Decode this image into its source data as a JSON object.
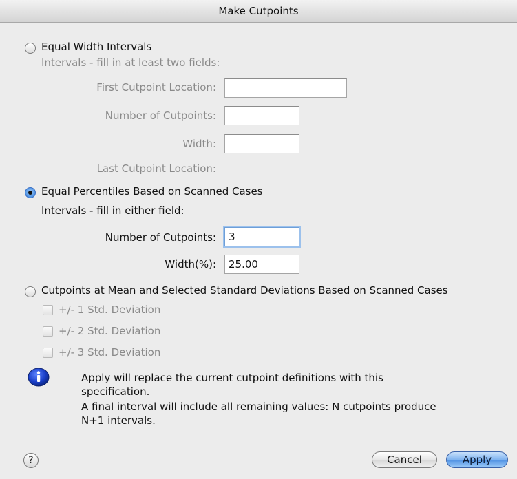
{
  "window": {
    "title": "Make Cutpoints"
  },
  "equal_width": {
    "label": "Equal Width Intervals",
    "hint": "Intervals - fill in at least two fields:",
    "first_cutpoint_label": "First Cutpoint Location:",
    "first_cutpoint_value": "",
    "num_cutpoints_label": "Number of Cutpoints:",
    "num_cutpoints_value": "",
    "width_label": "Width:",
    "width_value": "",
    "last_cutpoint_label": "Last Cutpoint Location:"
  },
  "equal_percentiles": {
    "label": "Equal Percentiles Based on Scanned Cases",
    "hint": "Intervals - fill in either field:",
    "num_cutpoints_label": "Number of Cutpoints:",
    "num_cutpoints_value": "3",
    "width_label": "Width(%):",
    "width_value": "25.00"
  },
  "mean_sd": {
    "label": "Cutpoints at Mean and Selected Standard Deviations Based on Scanned Cases",
    "options": [
      "+/- 1 Std. Deviation",
      "+/- 2 Std. Deviation",
      "+/- 3 Std. Deviation"
    ]
  },
  "info": {
    "line1": "Apply will replace the current cutpoint definitions with this",
    "line2": "specification.",
    "line3": "A final interval will include all remaining values: N cutpoints produce",
    "line4": "N+1 intervals."
  },
  "buttons": {
    "help": "?",
    "cancel": "Cancel",
    "apply": "Apply"
  },
  "colors": {
    "accent": "#4d8fe2",
    "background": "#ececec",
    "disabled_text": "#8a8a8a",
    "info_icon": "#1a3fc9"
  },
  "icons": {
    "info": "info-icon",
    "help": "help-icon"
  }
}
